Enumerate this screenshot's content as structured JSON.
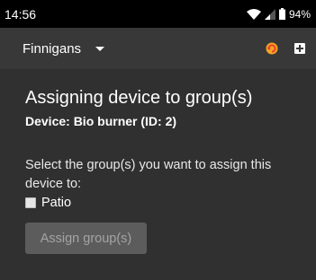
{
  "status_bar": {
    "time": "14:56",
    "battery": "94%"
  },
  "app_bar": {
    "group_name": "Finnigans"
  },
  "main": {
    "title": "Assigning device to group(s)",
    "device": "Device: Bio burner (ID: 2)",
    "prompt": "Select the group(s) you want to assign this device to:",
    "groups": [
      {
        "label": "Patio",
        "checked": false
      }
    ],
    "assign_button": "Assign group(s)"
  },
  "colors": {
    "accent": "#f5a623",
    "background": "#303030",
    "app_bar": "#383838"
  }
}
